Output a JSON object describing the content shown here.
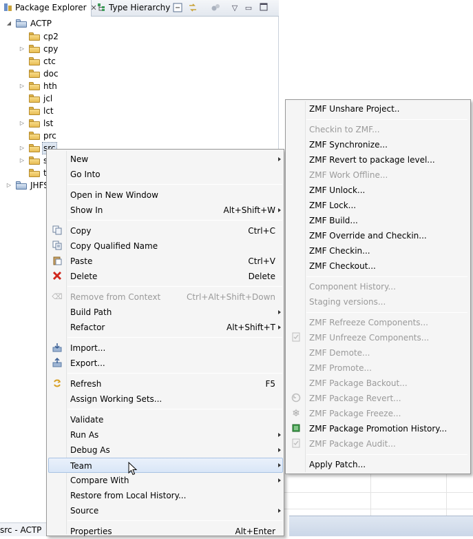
{
  "view": {
    "tab_package_explorer": "Package Explorer",
    "tab_type_hierarchy": "Type Hierarchy"
  },
  "tree": {
    "project": "ACTP",
    "folders": [
      "cp2",
      "cpy",
      "ctc",
      "doc",
      "hth",
      "jcl",
      "lct",
      "lst",
      "prc",
      "src",
      "s",
      "t"
    ],
    "project2": "JHFS"
  },
  "status": {
    "text": "src - ACTP"
  },
  "context_menu": {
    "items": [
      {
        "label": "New",
        "submenu": true
      },
      {
        "label": "Go Into"
      },
      {
        "label": "Open in New Window"
      },
      {
        "label": "Show In",
        "shortcut": "Alt+Shift+W",
        "submenu": true
      },
      {
        "label": "Copy",
        "shortcut": "Ctrl+C",
        "icon": "copy-icon"
      },
      {
        "label": "Copy Qualified Name",
        "icon": "copy-qualified-icon"
      },
      {
        "label": "Paste",
        "shortcut": "Ctrl+V",
        "icon": "paste-icon"
      },
      {
        "label": "Delete",
        "shortcut": "Delete",
        "icon": "delete-icon"
      },
      {
        "label": "Remove from Context",
        "shortcut": "Ctrl+Alt+Shift+Down",
        "disabled": true,
        "icon": "remove-context-icon"
      },
      {
        "label": "Build Path",
        "submenu": true
      },
      {
        "label": "Refactor",
        "shortcut": "Alt+Shift+T",
        "submenu": true
      },
      {
        "label": "Import...",
        "icon": "import-icon"
      },
      {
        "label": "Export...",
        "icon": "export-icon"
      },
      {
        "label": "Refresh",
        "shortcut": "F5",
        "icon": "refresh-icon"
      },
      {
        "label": "Assign Working Sets..."
      },
      {
        "label": "Validate"
      },
      {
        "label": "Run As",
        "submenu": true
      },
      {
        "label": "Debug As",
        "submenu": true
      },
      {
        "label": "Team",
        "submenu": true,
        "highlighted": true
      },
      {
        "label": "Compare With",
        "submenu": true
      },
      {
        "label": "Restore from Local History..."
      },
      {
        "label": "Source",
        "submenu": true
      },
      {
        "label": "Properties",
        "shortcut": "Alt+Enter"
      }
    ]
  },
  "team_menu": {
    "items": [
      {
        "label": "ZMF Unshare Project.."
      },
      {
        "label": "Checkin to ZMF...",
        "disabled": true
      },
      {
        "label": "ZMF Synchronize..."
      },
      {
        "label": "ZMF Revert to package level..."
      },
      {
        "label": "ZMF Work Offline...",
        "disabled": true
      },
      {
        "label": "ZMF Unlock..."
      },
      {
        "label": "ZMF Lock..."
      },
      {
        "label": "ZMF Build..."
      },
      {
        "label": "ZMF Override and Checkin..."
      },
      {
        "label": "ZMF Checkin..."
      },
      {
        "label": "ZMF Checkout..."
      },
      {
        "label": "Component History...",
        "disabled": true
      },
      {
        "label": "Staging versions...",
        "disabled": true
      },
      {
        "label": "ZMF Refreeze Components...",
        "disabled": true
      },
      {
        "label": "ZMF Unfreeze Components...",
        "disabled": true,
        "icon": "unfreeze-icon"
      },
      {
        "label": "ZMF Demote...",
        "disabled": true
      },
      {
        "label": "ZMF Promote...",
        "disabled": true
      },
      {
        "label": "ZMF Package Backout...",
        "disabled": true
      },
      {
        "label": "ZMF Package Revert...",
        "disabled": true,
        "icon": "package-revert-icon"
      },
      {
        "label": "ZMF Package Freeze...",
        "disabled": true,
        "icon": "package-freeze-icon"
      },
      {
        "label": "ZMF Package Promotion History...",
        "icon": "promotion-history-icon"
      },
      {
        "label": "ZMF Package Audit...",
        "disabled": true,
        "icon": "package-audit-icon"
      },
      {
        "label": "Apply Patch..."
      }
    ]
  }
}
